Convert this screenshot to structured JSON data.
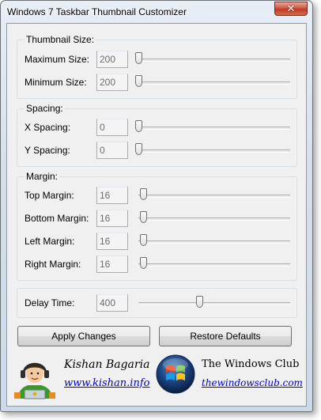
{
  "window": {
    "title": "Windows 7 Taskbar Thumbnail Customizer",
    "close_label": "✕"
  },
  "groups": {
    "thumbnail_size": {
      "legend": "Thumbnail Size:",
      "rows": [
        {
          "label": "Maximum Size:",
          "value": "200",
          "slider_fraction": 0.0
        },
        {
          "label": "Minimum Size:",
          "value": "200",
          "slider_fraction": 0.0
        }
      ]
    },
    "spacing": {
      "legend": "Spacing:",
      "rows": [
        {
          "label": "X Spacing:",
          "value": "0",
          "slider_fraction": 0.0
        },
        {
          "label": "Y Spacing:",
          "value": "0",
          "slider_fraction": 0.0
        }
      ]
    },
    "margin": {
      "legend": "Margin:",
      "rows": [
        {
          "label": "Top Margin:",
          "value": "16",
          "slider_fraction": 0.03
        },
        {
          "label": "Bottom Margin:",
          "value": "16",
          "slider_fraction": 0.03
        },
        {
          "label": "Left Margin:",
          "value": "16",
          "slider_fraction": 0.03
        },
        {
          "label": "Right Margin:",
          "value": "16",
          "slider_fraction": 0.03
        }
      ]
    },
    "delay": {
      "rows": [
        {
          "label": "Delay Time:",
          "value": "400",
          "slider_fraction": 0.4
        }
      ]
    }
  },
  "buttons": {
    "apply": "Apply Changes",
    "restore": "Restore Defaults"
  },
  "credits": {
    "author_name": "Kishan Bagaria",
    "author_link": "www.kishan.info",
    "club_name": "The Windows Club",
    "club_link": "thewindowsclub.com",
    "icons": [
      "avatar-icon",
      "windows-logo-icon"
    ]
  }
}
